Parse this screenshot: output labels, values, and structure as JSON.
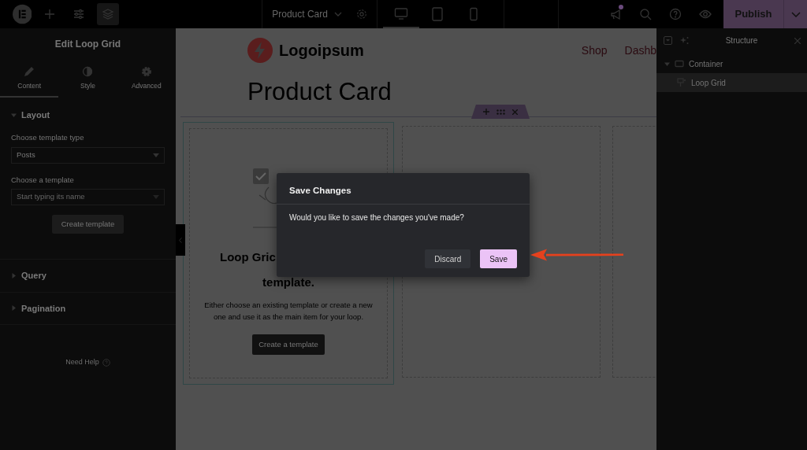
{
  "top_bar": {
    "tools": [
      {
        "kind": "add",
        "selected": false
      },
      {
        "kind": "settings",
        "selected": false
      },
      {
        "kind": "layers",
        "selected": true
      }
    ],
    "document_title": "Product Card",
    "devices": [
      {
        "kind": "desktop",
        "selected": true
      },
      {
        "kind": "tablet",
        "selected": false
      },
      {
        "kind": "mobile",
        "selected": false
      }
    ],
    "actions": [
      {
        "kind": "megaphone",
        "notification": true
      },
      {
        "kind": "search",
        "notification": false
      },
      {
        "kind": "help",
        "notification": false
      },
      {
        "kind": "preview",
        "notification": false
      }
    ],
    "publish": "Publish"
  },
  "left_panel": {
    "title": "Edit Loop Grid",
    "tabs": [
      {
        "label": "Content",
        "kind": "pencil",
        "selected": true
      },
      {
        "label": "Style",
        "kind": "contrast",
        "selected": false
      },
      {
        "label": "Advanced",
        "kind": "gear",
        "selected": false
      }
    ],
    "sections": [
      {
        "title": "Layout",
        "expanded": true,
        "fields": [
          {
            "label": "Choose template type",
            "value": "Posts"
          },
          {
            "label": "Choose a template",
            "placeholder": "Start typing its name"
          }
        ],
        "button": "Create template"
      },
      {
        "title": "Query",
        "expanded": false
      },
      {
        "title": "Pagination",
        "expanded": false
      }
    ],
    "help": "Need Help"
  },
  "canvas": {
    "logo": "Logoipsum",
    "nav": [
      "Shop",
      "Dashb"
    ],
    "heading": "Product Card",
    "loop_card": {
      "heading_lines": [
        "Loop Gric",
        "template."
      ],
      "text": "Either choose an existing template or create a new one and use it as the main item for your loop.",
      "button": "Create a template"
    }
  },
  "structure_panel": {
    "title": "Structure",
    "tree": [
      {
        "label": "Container",
        "kind": "container",
        "expanded": true,
        "selected": false,
        "children": [
          {
            "label": "Loop Grid",
            "kind": "loop",
            "selected": true
          }
        ]
      }
    ]
  },
  "dialog": {
    "title": "Save Changes",
    "message": "Would you like to save the changes you've made?",
    "buttons": [
      {
        "label": "Discard",
        "kind": "secondary"
      },
      {
        "label": "Save",
        "kind": "primary"
      }
    ]
  }
}
